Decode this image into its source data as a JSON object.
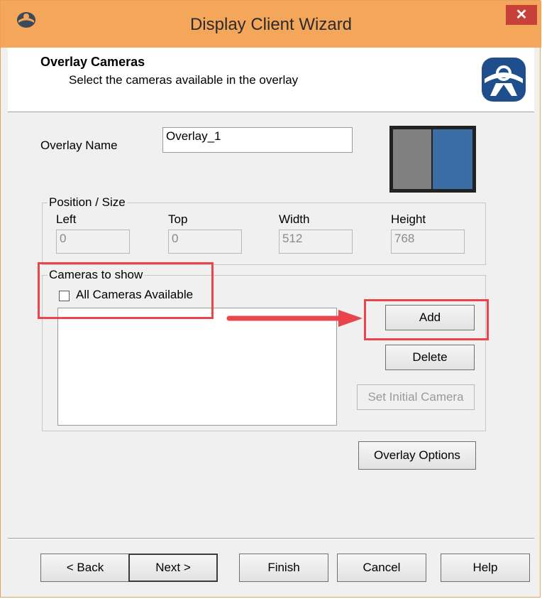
{
  "window": {
    "title": "Display Client Wizard",
    "close_glyph": "✕",
    "app_icon": "thinmanager-icon"
  },
  "header": {
    "title": "Overlay Cameras",
    "subtitle": "Select the cameras available in the overlay",
    "logo": "thinmanager-logo"
  },
  "overlay": {
    "name_label": "Overlay Name",
    "name_value": "Overlay_1",
    "preview": {
      "left_color": "#808080",
      "right_color": "#3a6ea5"
    }
  },
  "position_size": {
    "group_label": "Position / Size",
    "fields": [
      {
        "label": "Left",
        "value": "0"
      },
      {
        "label": "Top",
        "value": "0"
      },
      {
        "label": "Width",
        "value": "512"
      },
      {
        "label": "Height",
        "value": "768"
      }
    ]
  },
  "cameras": {
    "group_label": "Cameras to show",
    "all_available_label": "All Cameras Available",
    "all_available_checked": false,
    "items": []
  },
  "buttons": {
    "add": "Add",
    "delete": "Delete",
    "set_initial": "Set Initial Camera",
    "overlay_options": "Overlay Options"
  },
  "footer": {
    "back": "< Back",
    "next": "Next >",
    "finish": "Finish",
    "cancel": "Cancel",
    "help": "Help"
  },
  "annotation_color": "#e8454c"
}
